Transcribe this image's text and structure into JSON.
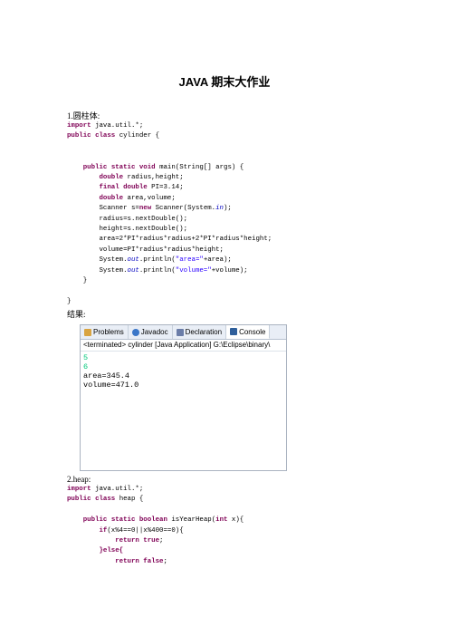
{
  "title": "JAVA 期末大作业",
  "sec1": {
    "label": "1.圆柱体:",
    "l1": "java.util.*;",
    "l2": "cylinder {",
    "l3": "main(String[] args) {",
    "l4": "radius,height;",
    "l5": "PI=3.14;",
    "l6": "area,volume;",
    "l7a": "Scanner s=",
    "l7b": "Scanner(System.",
    "l7c": "in",
    "l7d": ");",
    "l8": "radius=s.nextDouble();",
    "l9": "height=s.nextDouble();",
    "l10": "area=2*PI*radius*radius+2*PI*radius*height;",
    "l11": "volume=PI*radius*radius*height;",
    "l12s": "\"area=\"",
    "l12t": "+area);",
    "l13s": "\"volume=\"",
    "l13t": "+volume);",
    "close1": "}",
    "close2": "}"
  },
  "kw": {
    "import": "import",
    "public": "public",
    "class": "class",
    "static": "static",
    "void": "void",
    "double": "double",
    "final": "final",
    "new": "new",
    "boolean": "boolean",
    "int": "int",
    "if": "if",
    "return": "return",
    "true": "true",
    "false": "false",
    "else": "}else{",
    "sysprint": "System.",
    "out": "out",
    "println": ".println("
  },
  "result_label": "结果:",
  "console": {
    "tabs": [
      "Problems",
      "Javadoc",
      "Declaration",
      "Console"
    ],
    "status": "<terminated> cylinder [Java Application] G:\\Eclipse\\binary\\",
    "input1": "5",
    "input2": "6",
    "out1": "area=345.4",
    "out2": "volume=471.0"
  },
  "sec2": {
    "label": "2.heap:",
    "l1": "java.util.*;",
    "l2": "heap {",
    "l3a": "isYearHeap(",
    "l3b": "x){",
    "l4": "(x%4==0||x%400==0){",
    "ret": ";"
  }
}
